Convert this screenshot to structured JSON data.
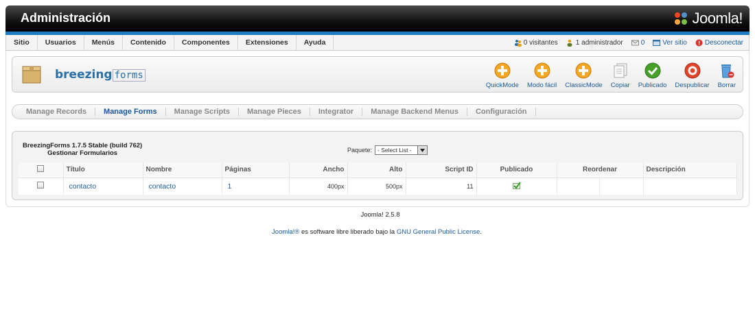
{
  "header": {
    "title": "Administración",
    "logo_text": "Joomla!"
  },
  "menu": [
    "Sitio",
    "Usuarios",
    "Menús",
    "Contenido",
    "Componentes",
    "Extensiones",
    "Ayuda"
  ],
  "status": {
    "visitors": "0 visitantes",
    "admins": "1 administrador",
    "messages": "0",
    "view_site": "Ver sitio",
    "logout": "Desconectar"
  },
  "brand": {
    "name_bold": "breezing",
    "name_forms": "forms"
  },
  "toolbar": [
    {
      "label": "QuickMode",
      "icon": "plus-orange-icon"
    },
    {
      "label": "Modo fácil",
      "icon": "plus-orange-icon"
    },
    {
      "label": "ClassicMode",
      "icon": "plus-orange-icon"
    },
    {
      "label": "Copiar",
      "icon": "copy-icon"
    },
    {
      "label": "Publicado",
      "icon": "check-green-icon"
    },
    {
      "label": "Despublicar",
      "icon": "stop-red-icon"
    },
    {
      "label": "Borrar",
      "icon": "trash-icon"
    }
  ],
  "tabs": [
    "Manage Records",
    "Manage Forms",
    "Manage Scripts",
    "Manage Pieces",
    "Integrator",
    "Manage Backend Menus",
    "Configuración"
  ],
  "active_tab": "Manage Forms",
  "version": {
    "line1": "BreezingForms 1.7.5 Stable (build 762)",
    "line2": "Gestionar Formularios"
  },
  "package": {
    "label": "Paquete:",
    "selected": "- Select List -"
  },
  "table": {
    "headers": [
      "Título",
      "Nombre",
      "Páginas",
      "Ancho",
      "Alto",
      "Script ID",
      "Publicado",
      "Reordenar",
      "Descripción"
    ],
    "rows": [
      {
        "titulo": "contacto",
        "nombre": "contacto",
        "paginas": "1",
        "ancho": "400px",
        "alto": "500px",
        "script_id": "11",
        "publicado": true,
        "descripcion": ""
      }
    ]
  },
  "footer": {
    "version": "Joomla! 2.5.8",
    "lic_brand": "Joomla!®",
    "lic_text": " es software libre liberado bajo la ",
    "lic_link": "GNU General Public License",
    "lic_end": "."
  }
}
